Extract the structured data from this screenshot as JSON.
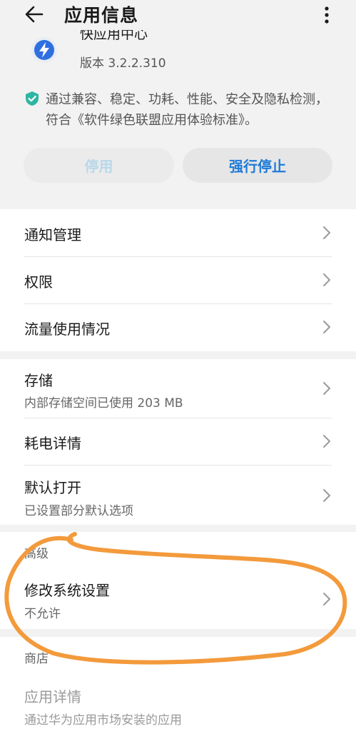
{
  "header": {
    "title": "应用信息"
  },
  "app": {
    "name": "快应用中心",
    "version": "版本 3.2.2.310"
  },
  "verification": {
    "text": "通过兼容、稳定、功耗、性能、安全及隐私检测，符合《软件绿色联盟应用体验标准》。"
  },
  "buttons": {
    "disable": "停用",
    "force_stop": "强行停止"
  },
  "section1": [
    {
      "title": "通知管理"
    },
    {
      "title": "权限"
    },
    {
      "title": "流量使用情况"
    }
  ],
  "section2": [
    {
      "title": "存储",
      "subtitle": "内部存储空间已使用 203 MB"
    },
    {
      "title": "耗电详情"
    },
    {
      "title": "默认打开",
      "subtitle": "已设置部分默认选项"
    }
  ],
  "advanced": {
    "label": "高级",
    "item": {
      "title": "修改系统设置",
      "subtitle": "不允许"
    }
  },
  "store": {
    "label": "商店",
    "item": {
      "title": "应用详情",
      "subtitle": "通过华为应用市场安装的应用"
    }
  },
  "colors": {
    "accent": "#1f7bd8",
    "annotation": "#f39a3c",
    "background": "#f2f2f2"
  },
  "icons": [
    "back-arrow-icon",
    "more-vert-icon",
    "app-logo-icon",
    "verified-shield-icon",
    "chevron-right-icon"
  ]
}
